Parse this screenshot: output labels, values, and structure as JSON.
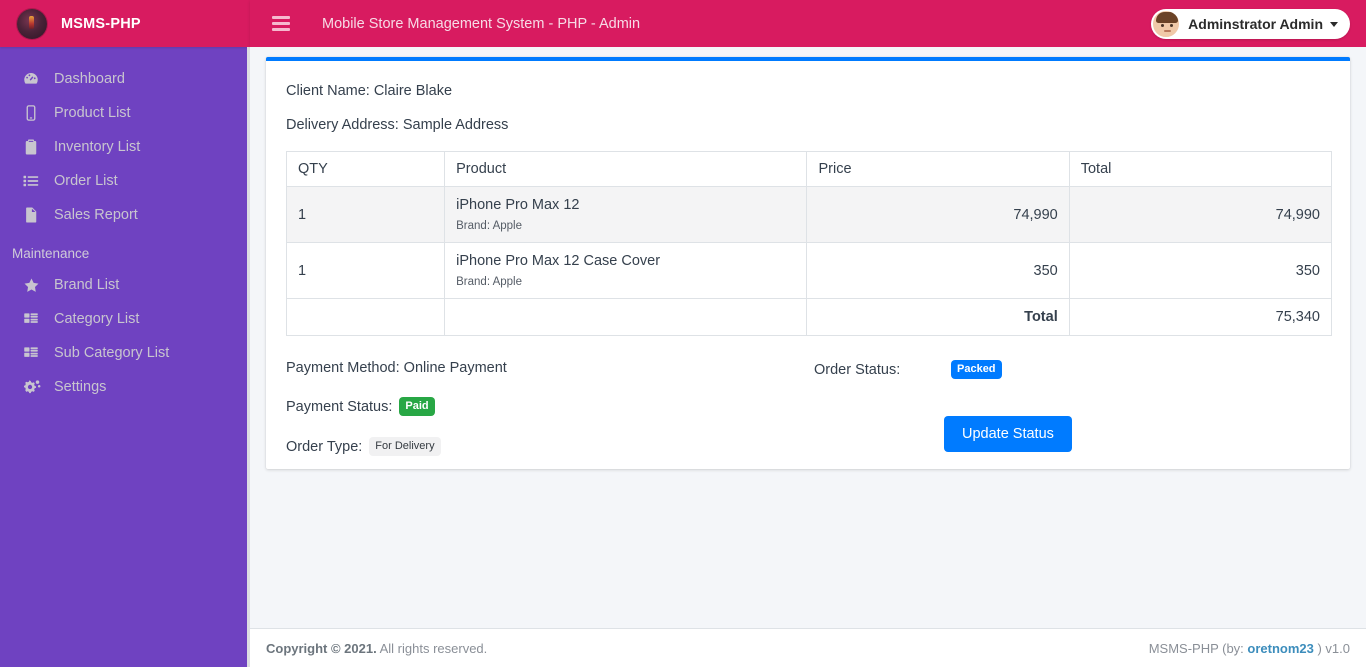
{
  "brand": {
    "title": "MSMS-PHP",
    "logo_icon": "app-logo-icon"
  },
  "topbar": {
    "menu_icon": "hamburger-menu-icon",
    "title": "Mobile Store Management System - PHP - Admin",
    "user_name": "Adminstrator Admin",
    "caret_icon": "chevron-down-icon",
    "avatar_icon": "user-avatar-icon"
  },
  "sidebar": {
    "items": [
      {
        "label": "Dashboard",
        "icon": "dashboard-gauge-icon"
      },
      {
        "label": "Product List",
        "icon": "mobile-phone-icon"
      },
      {
        "label": "Inventory List",
        "icon": "clipboard-list-icon"
      },
      {
        "label": "Order List",
        "icon": "list-ul-icon"
      },
      {
        "label": "Sales Report",
        "icon": "file-document-icon"
      }
    ],
    "maintenance_header": "Maintenance",
    "maintenance_items": [
      {
        "label": "Brand List",
        "icon": "star-icon"
      },
      {
        "label": "Category List",
        "icon": "table-grid-icon"
      },
      {
        "label": "Sub Category List",
        "icon": "table-grid-icon"
      },
      {
        "label": "Settings",
        "icon": "gears-icon"
      }
    ]
  },
  "order": {
    "client_name": "Client Name: Claire Blake",
    "delivery_address": "Delivery Address: Sample Address",
    "table": {
      "headers": [
        "QTY",
        "Product",
        "Price",
        "Total"
      ],
      "rows": [
        {
          "qty": "1",
          "product": "iPhone Pro Max 12",
          "brand": "Brand: Apple",
          "price": "74,990",
          "total": "74,990"
        },
        {
          "qty": "1",
          "product": "iPhone Pro Max 12 Case Cover",
          "brand": "Brand: Apple",
          "price": "350",
          "total": "350"
        }
      ],
      "total_label": "Total",
      "total_value": "75,340"
    },
    "payment_method": "Payment Method: Online Payment",
    "payment_status_label": "Payment Status:",
    "payment_status_badge": "Paid",
    "order_type_label": "Order Type:",
    "order_type_badge": "For Delivery",
    "order_status_label": "Order Status:",
    "order_status_badge": "Packed",
    "update_button": "Update Status"
  },
  "footer": {
    "copyright_bold": "Copyright © 2021.",
    "copyright_rest": " All rights reserved.",
    "right_prefix": "MSMS-PHP (by: ",
    "right_link": "oretnom23",
    "right_suffix": " ) v1.0"
  },
  "colors": {
    "header_pink": "#d81b60",
    "sidebar_purple": "#6f42c1",
    "accent_blue": "#007bff",
    "success_green": "#28a745",
    "page_bg": "#f4f6f9"
  }
}
